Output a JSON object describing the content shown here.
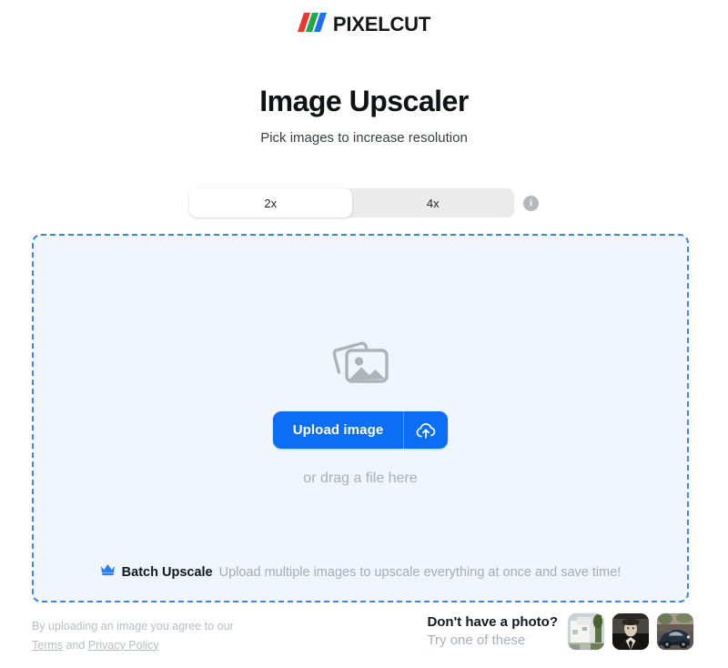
{
  "brand": {
    "logo_icon": "pixelcut-slashes-icon",
    "name": "PIXELCUT",
    "slash_colors": [
      "#e8392f",
      "#22a845",
      "#1f6ef3"
    ]
  },
  "header": {
    "title": "Image Upscaler",
    "subtitle": "Pick images to increase resolution"
  },
  "scale_toggle": {
    "options": [
      {
        "label": "2x",
        "selected": true
      },
      {
        "label": "4x",
        "selected": false
      }
    ],
    "info_icon": "info-icon",
    "info_glyph": "i"
  },
  "dropzone": {
    "placeholder_icon": "photo-stack-icon",
    "upload_button": {
      "label": "Upload image",
      "icon": "cloud-upload-icon",
      "color": "#0b6ef5"
    },
    "drag_hint": "or drag a file here",
    "batch": {
      "icon": "crown-icon",
      "icon_color": "#2f7ef5",
      "title": "Batch Upscale",
      "description": "Upload multiple images to upscale everything at once and save time!"
    },
    "border_color": "#3b82f6",
    "background_color": "#f1f6fe"
  },
  "footer": {
    "legal_prefix": "By uploading an image you agree to our",
    "terms_label": "Terms",
    "and_label": "and",
    "privacy_label": "Privacy Policy",
    "samples": {
      "title": "Don't have a photo?",
      "subtitle": "Try one of these",
      "thumbnails": [
        {
          "name": "sample-thumbnail-house",
          "alt": "White modern house with trees"
        },
        {
          "name": "sample-thumbnail-portrait",
          "alt": "Black and white vintage portrait of a man in a hat"
        },
        {
          "name": "sample-thumbnail-car",
          "alt": "Vintage car photo"
        }
      ]
    }
  }
}
